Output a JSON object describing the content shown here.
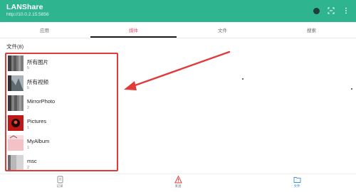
{
  "app": {
    "title": "LANShare",
    "url": "http://10.0.2.15:5856"
  },
  "tabs": [
    {
      "label": "应用",
      "active": false
    },
    {
      "label": "媒体",
      "active": true
    },
    {
      "label": "文件",
      "active": false
    },
    {
      "label": "搜索",
      "active": false
    }
  ],
  "section": {
    "title": "文件(8)"
  },
  "albums": [
    {
      "name": "所有图片",
      "count": "5",
      "thumb": "grey-thumbnail"
    },
    {
      "name": "所有视频",
      "count": "5",
      "thumb": "landscape-thumbnail"
    },
    {
      "name": "MirrorPhoto",
      "count": "2",
      "thumb": "grey-thumbnail"
    },
    {
      "name": "Pictures",
      "count": "1",
      "thumb": "red-thumbnail"
    },
    {
      "name": "MyAlbum",
      "count": "1",
      "thumb": "pink-thumbnail"
    },
    {
      "name": "msc",
      "count": "2",
      "thumb": "grey-thumbnail"
    }
  ],
  "bottom_nav": [
    {
      "label": "记录",
      "icon": "record-icon",
      "active": false
    },
    {
      "label": "发送",
      "icon": "send-icon",
      "active": false
    },
    {
      "label": "文件",
      "icon": "folder-icon",
      "active": true
    }
  ],
  "colors": {
    "app_bar": "#2eb48f",
    "active_tab": "#e05679",
    "highlight": "#e03a3a",
    "active_nav": "#3a8de0"
  }
}
